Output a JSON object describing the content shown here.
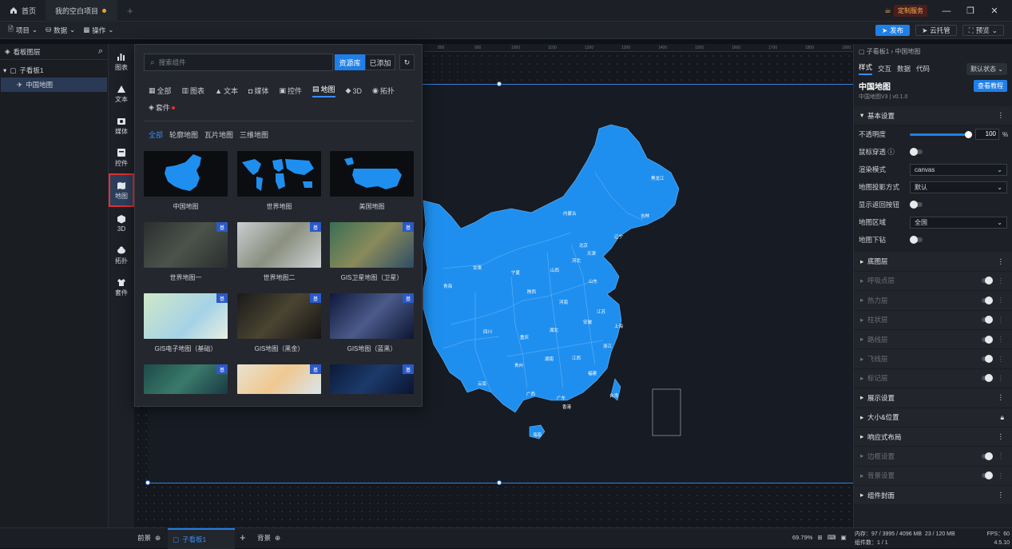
{
  "titlebar": {
    "tabs": [
      {
        "label": "首页"
      },
      {
        "label": "我的空白项目"
      }
    ],
    "custom_service": "定制服务",
    "colors": {
      "accent": "#1f7fe8",
      "alert": "#e03030",
      "map_fill": "#1f8fef"
    }
  },
  "toolbar": {
    "menus": [
      {
        "label": "项目"
      },
      {
        "label": "数据"
      },
      {
        "label": "操作"
      }
    ],
    "publish": "发布",
    "cloud": "云托管",
    "preview": "预览"
  },
  "layers": {
    "title": "看板图层",
    "items": [
      {
        "label": "子看板1"
      },
      {
        "label": "中国地图"
      }
    ]
  },
  "iconbar": [
    {
      "label": "图表",
      "icon": "chart-icon"
    },
    {
      "label": "文本",
      "icon": "text-icon"
    },
    {
      "label": "媒体",
      "icon": "media-icon"
    },
    {
      "label": "控件",
      "icon": "control-icon"
    },
    {
      "label": "地图",
      "icon": "map-icon"
    },
    {
      "label": "3D",
      "icon": "cube-icon"
    },
    {
      "label": "拓扑",
      "icon": "topology-icon"
    },
    {
      "label": "套件",
      "icon": "kit-icon"
    }
  ],
  "ruler": {
    "ticks": [
      "800",
      "900",
      "1000",
      "1100",
      "1200",
      "1300",
      "1400",
      "1500",
      "1600",
      "1700",
      "1800",
      "1900"
    ]
  },
  "popup": {
    "search_placeholder": "搜索组件",
    "btn_library": "资源库",
    "btn_added": "已添加",
    "categories": [
      {
        "label": "全部"
      },
      {
        "label": "图表"
      },
      {
        "label": "文本"
      },
      {
        "label": "媒体"
      },
      {
        "label": "控件"
      },
      {
        "label": "地图"
      },
      {
        "label": "3D"
      },
      {
        "label": "拓扑"
      },
      {
        "label": "套件"
      }
    ],
    "subcategories": [
      {
        "label": "全部"
      },
      {
        "label": "轮廓地图"
      },
      {
        "label": "瓦片地图"
      },
      {
        "label": "三维地图"
      }
    ],
    "cards": [
      {
        "label": "中国地图"
      },
      {
        "label": "世界地图"
      },
      {
        "label": "美国地图"
      },
      {
        "label": "世界地图一"
      },
      {
        "label": "世界地图二"
      },
      {
        "label": "GIS卫星地图（卫星）"
      },
      {
        "label": "GIS电子地图（基础）"
      },
      {
        "label": "GIS地图（黑金）"
      },
      {
        "label": "GIS地图（蓝黑）"
      },
      {
        "label": ""
      },
      {
        "label": ""
      },
      {
        "label": ""
      }
    ],
    "badge": "基"
  },
  "map_labels": {
    "heilongjiang": "黑龙江",
    "jilin": "吉林",
    "liaoning": "辽宁",
    "neimenggu": "内蒙古",
    "beijing": "北京",
    "tianjin": "天津",
    "hebei": "河北",
    "shandong": "山东",
    "shanxi": "山西",
    "shaanxi": "陕西",
    "henan": "河南",
    "jiangsu": "江苏",
    "anhui": "安徽",
    "shanghai": "上海",
    "zhejiang": "浙江",
    "hubei": "湖北",
    "hunan": "湖南",
    "jiangxi": "江西",
    "fujian": "福建",
    "guangdong": "广东",
    "guangxi": "广西",
    "hainan": "海南",
    "guizhou": "贵州",
    "yunnan": "云南",
    "sichuan": "四川",
    "chongqing": "重庆",
    "gansu": "甘肃",
    "ningxia": "宁夏",
    "qinghai": "青海",
    "taiwan": "台湾",
    "xianggang": "香港"
  },
  "right": {
    "breadcrumb": "子看板1 › 中国地图",
    "tabs": [
      {
        "label": "样式"
      },
      {
        "label": "交互"
      },
      {
        "label": "数据"
      },
      {
        "label": "代码"
      }
    ],
    "state": "默认状态",
    "title": "中国地图",
    "version": "中国地图V3 | v0.1.0",
    "tutorial": "查看教程",
    "basic_title": "基本设置",
    "opacity_label": "不透明度",
    "opacity_value": "100",
    "opacity_unit": "%",
    "opacity_level": 1.0,
    "mouse_through": "鼠标穿透",
    "render_mode": "渲染模式",
    "render_mode_value": "canvas",
    "projection": "地图投影方式",
    "projection_value": "默认",
    "show_back": "显示返回按钮",
    "region": "地图区域",
    "region_value": "全国",
    "drilldown": "地图下钻",
    "sections": [
      {
        "label": "底图层",
        "dim": false,
        "toggle": false,
        "lock": false
      },
      {
        "label": "呼吸点层",
        "dim": true,
        "toggle": true,
        "lock": false
      },
      {
        "label": "热力层",
        "dim": true,
        "toggle": true,
        "lock": false
      },
      {
        "label": "柱状层",
        "dim": true,
        "toggle": true,
        "lock": false
      },
      {
        "label": "路线层",
        "dim": true,
        "toggle": true,
        "lock": false
      },
      {
        "label": "飞线层",
        "dim": true,
        "toggle": true,
        "lock": false
      },
      {
        "label": "标记层",
        "dim": true,
        "toggle": true,
        "lock": false
      },
      {
        "label": "展示设置",
        "dim": false,
        "toggle": false,
        "lock": false
      },
      {
        "label": "大小&位置",
        "dim": false,
        "toggle": false,
        "lock": true
      },
      {
        "label": "响应式布局",
        "dim": false,
        "toggle": false,
        "lock": false
      },
      {
        "label": "边框设置",
        "dim": true,
        "toggle": true,
        "lock": false
      },
      {
        "label": "背景设置",
        "dim": true,
        "toggle": true,
        "lock": false
      },
      {
        "label": "组件封面",
        "dim": false,
        "toggle": false,
        "lock": false
      }
    ]
  },
  "bottom": {
    "foreground": "前景",
    "board_tab": "子看板1",
    "background": "背景",
    "zoom": "69.79%",
    "memory": "内存：97 / 3995 / 4096 MB",
    "memory2": "23 / 120 MB",
    "fps": "FPS：60",
    "count": "组件数：1 / 1",
    "version": "4.5.10"
  }
}
